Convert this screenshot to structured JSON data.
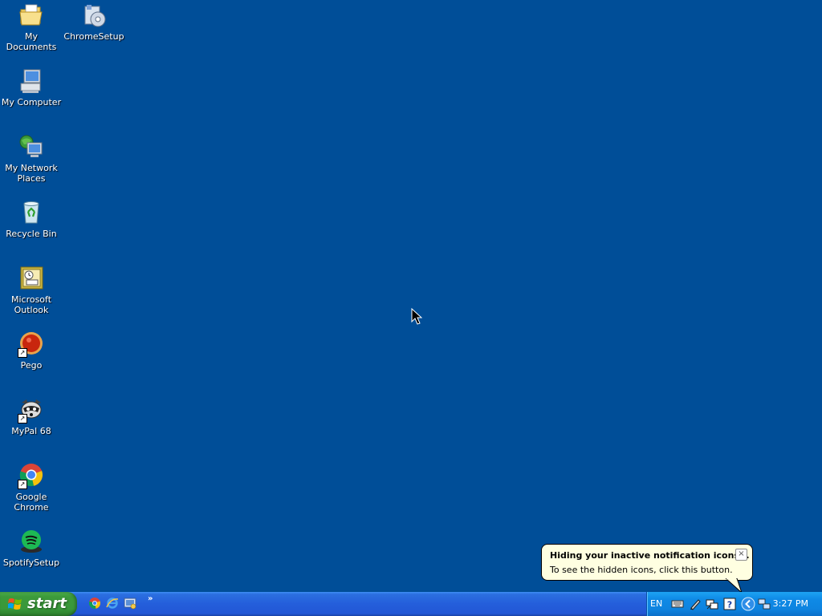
{
  "desktop": {
    "background_color": "#004e98",
    "icons": [
      {
        "name": "my-documents",
        "label": "My Documents",
        "icon": "folder-icon"
      },
      {
        "name": "chromesetup",
        "label": "ChromeSetup",
        "icon": "installer-icon"
      },
      {
        "name": "my-computer",
        "label": "My Computer",
        "icon": "computer-icon"
      },
      {
        "name": "my-network-places",
        "label": "My Network\nPlaces",
        "icon": "network-icon"
      },
      {
        "name": "recycle-bin",
        "label": "Recycle Bin",
        "icon": "recycle-bin-icon"
      },
      {
        "name": "microsoft-outlook",
        "label": "Microsoft\nOutlook",
        "icon": "outlook-icon"
      },
      {
        "name": "pego",
        "label": "Pego",
        "icon": "pego-icon"
      },
      {
        "name": "mypal-68",
        "label": "MyPal 68",
        "icon": "raccoon-icon"
      },
      {
        "name": "google-chrome",
        "label": "Google Chrome",
        "icon": "chrome-icon"
      },
      {
        "name": "spotifysetup",
        "label": "SpotifySetup",
        "icon": "spotify-icon"
      }
    ]
  },
  "taskbar": {
    "start_label": "start",
    "quick_launch": [
      "chrome-icon",
      "ie-icon",
      "show-desktop-icon"
    ],
    "quick_launch_chevron": "»",
    "tray": {
      "language": "EN",
      "icons": [
        "keyboard-icon",
        "pen-icon",
        "network-connection-icon",
        "help-icon",
        "show-hidden-icons-button",
        "network-computers-icon"
      ],
      "clock": "3:27 PM"
    }
  },
  "balloon": {
    "title": "Hiding your inactive notification icons...",
    "body": "To see the hidden icons, click this button.",
    "close_label": "×"
  }
}
